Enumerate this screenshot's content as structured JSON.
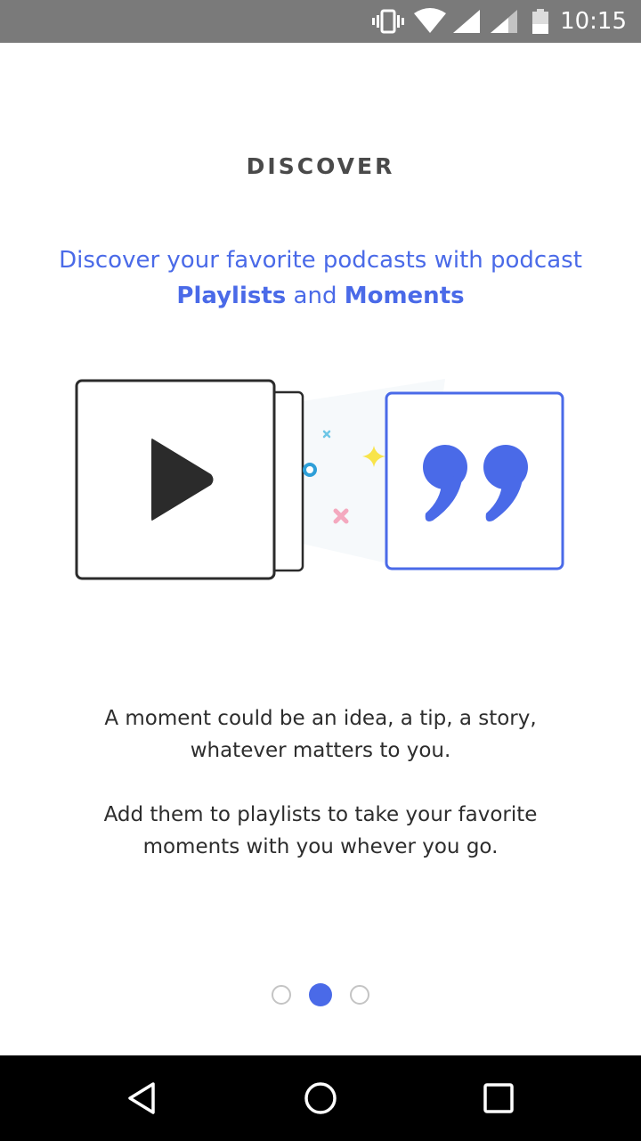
{
  "status_bar": {
    "time": "10:15",
    "icons": [
      "vibrate-icon",
      "wifi-icon",
      "signal-icon",
      "signal-icon",
      "battery-icon"
    ]
  },
  "onboarding": {
    "section_title": "DISCOVER",
    "headline": {
      "line1": "Discover your favorite podcasts with podcast",
      "playlists": "Playlists",
      "and": "and",
      "moments": "Moments"
    },
    "description_1": {
      "line1": "A moment could be an idea, a tip, a story,",
      "line2": "whatever matters to you."
    },
    "description_2": {
      "line1": "Add them to playlists to take your favorite",
      "line2": "moments with you whever you go."
    },
    "illustration_icons": [
      "play-icon",
      "quote-icon"
    ],
    "pager": {
      "total": 3,
      "active_index": 1
    }
  },
  "colors": {
    "accent": "#4a6ae8",
    "title_gray": "#4a4a4a",
    "body_text": "#2d2d2d",
    "status_bar": "#7a7a7a",
    "nav_bar": "#000000",
    "sparkle_yellow": "#f8e44a",
    "sparkle_pink": "#f4a9bf",
    "sparkle_blue": "#2e9fd8"
  },
  "nav_bar": {
    "buttons": [
      "back-icon",
      "home-icon",
      "recents-icon"
    ]
  }
}
